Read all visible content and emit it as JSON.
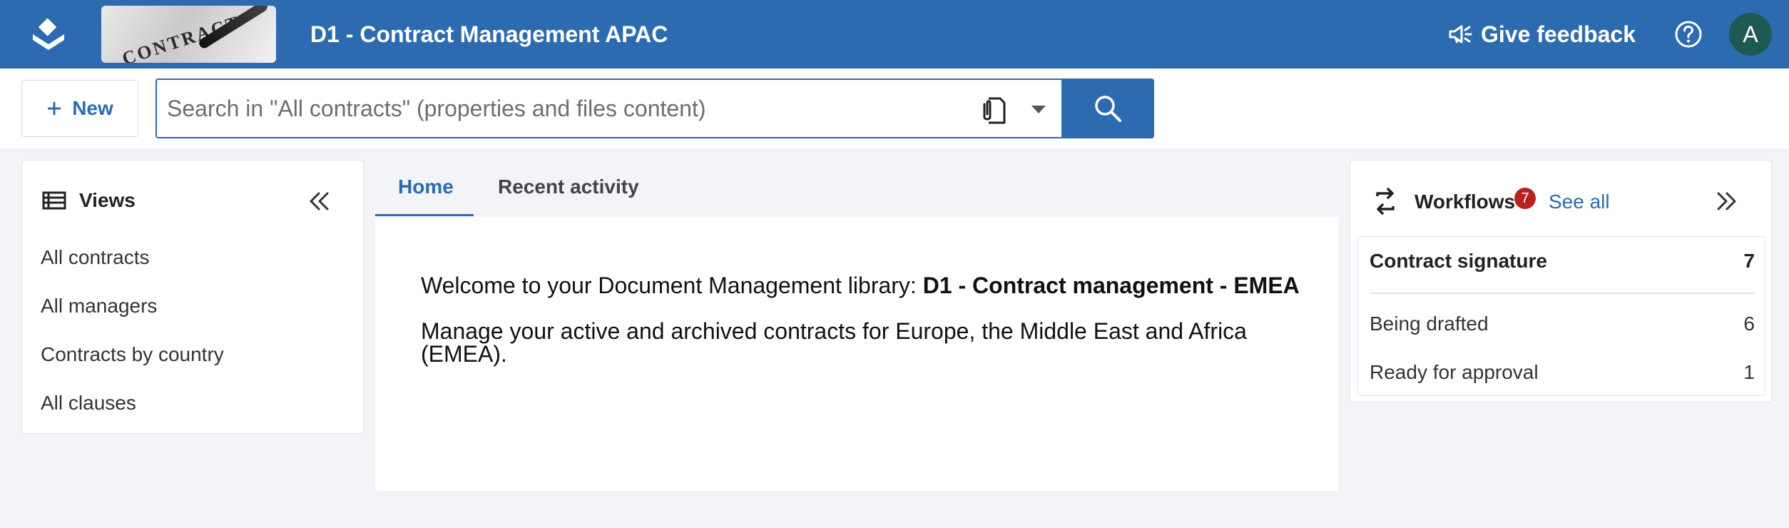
{
  "header": {
    "banner_text": "CONTRACT",
    "title": "D1 - Contract Management APAC",
    "feedback_label": "Give feedback",
    "avatar_initial": "A",
    "color": "#2d6bb0"
  },
  "toolbar": {
    "new_label": "New",
    "search_placeholder": "Search in \"All contracts\" (properties and files content)"
  },
  "views": {
    "title": "Views",
    "items": [
      "All contracts",
      "All managers",
      "Contracts by country",
      "All clauses"
    ]
  },
  "tabs": [
    {
      "label": "Home",
      "active": true
    },
    {
      "label": "Recent activity",
      "active": false
    }
  ],
  "home": {
    "welcome_prefix": "Welcome to your Document Management library:",
    "welcome_library": "D1 - Contract management - EMEA",
    "description": "Manage your active and archived contracts for Europe, the Middle East and Africa (EMEA)."
  },
  "workflows": {
    "title": "Workflows",
    "badge_count": "7",
    "see_all_label": "See all",
    "group": {
      "label": "Contract signature",
      "count": "7"
    },
    "items": [
      {
        "label": "Being drafted",
        "count": "6"
      },
      {
        "label": "Ready for approval",
        "count": "1"
      }
    ],
    "badge_color": "#b7221f"
  }
}
